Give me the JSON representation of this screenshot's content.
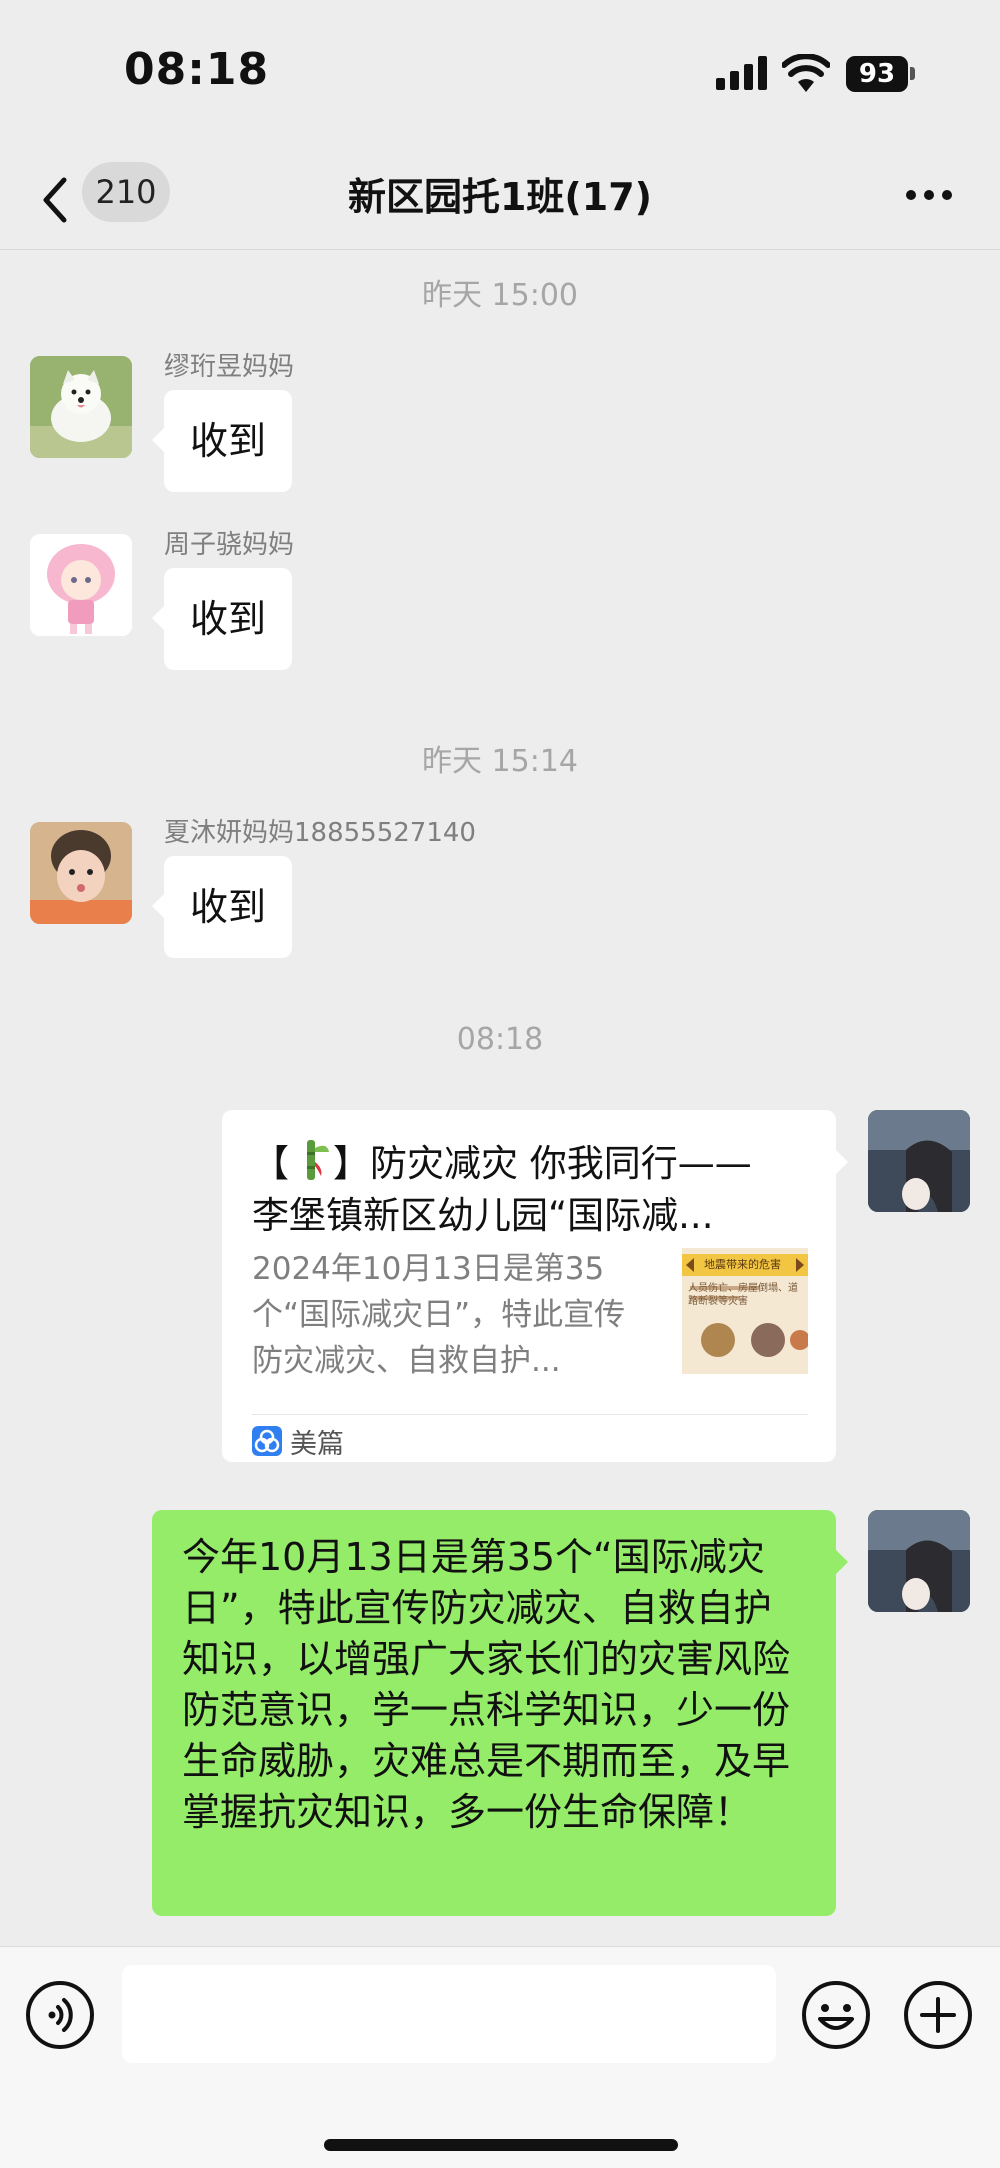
{
  "status_bar": {
    "time": "08:18",
    "battery": "93"
  },
  "nav": {
    "unread_count": "210",
    "title": "新区园托1班(17)"
  },
  "messages": [
    {
      "type": "timestamp",
      "text": "昨天 15:00"
    },
    {
      "type": "text",
      "side": "left",
      "sender": "缪珩昱妈妈",
      "text": "收到",
      "avatar": "white-dog-avatar"
    },
    {
      "type": "text",
      "side": "left",
      "sender": "周子骁妈妈",
      "text": "收到",
      "avatar": "anime-girl-avatar"
    },
    {
      "type": "timestamp",
      "text": "昨天 15:14"
    },
    {
      "type": "text",
      "side": "left",
      "sender": "夏沐妍妈妈18855527140",
      "text": "收到",
      "avatar": "child-photo-avatar"
    },
    {
      "type": "timestamp",
      "text": "08:18"
    },
    {
      "type": "link_card",
      "side": "right",
      "title_open": "【",
      "title_rest": "】防灾减灾 你我同行——",
      "title_line2": "李堡镇新区幼儿园“国际减...",
      "description": "2024年10月13日是第35个“国际减灾日”，特此宣传防灾减灾、自救自护...",
      "thumbnail_label": "地震带来的危害",
      "thumbnail_text": "人员伤亡、房屋倒塌、道路断裂等灾害",
      "source": "美篇"
    },
    {
      "type": "text",
      "side": "right",
      "text": "今年10月13日是第35个“国际减灾日”，特此宣传防灾减灾、自救自护知识，以增强广大家长们的灾害风险防范意识，学一点科学知识，少一份生命威胁，灾难总是不期而至，及早掌握抗灾知识，多一份生命保障！"
    }
  ],
  "colors": {
    "background": "#ededed",
    "bubble_self": "#95ec69",
    "bubble_other": "#ffffff"
  },
  "icons": {
    "back": "chevron-left-icon",
    "more": "ellipsis-icon",
    "voice": "voice-icon",
    "emoji": "emoji-icon",
    "plus": "plus-icon"
  }
}
